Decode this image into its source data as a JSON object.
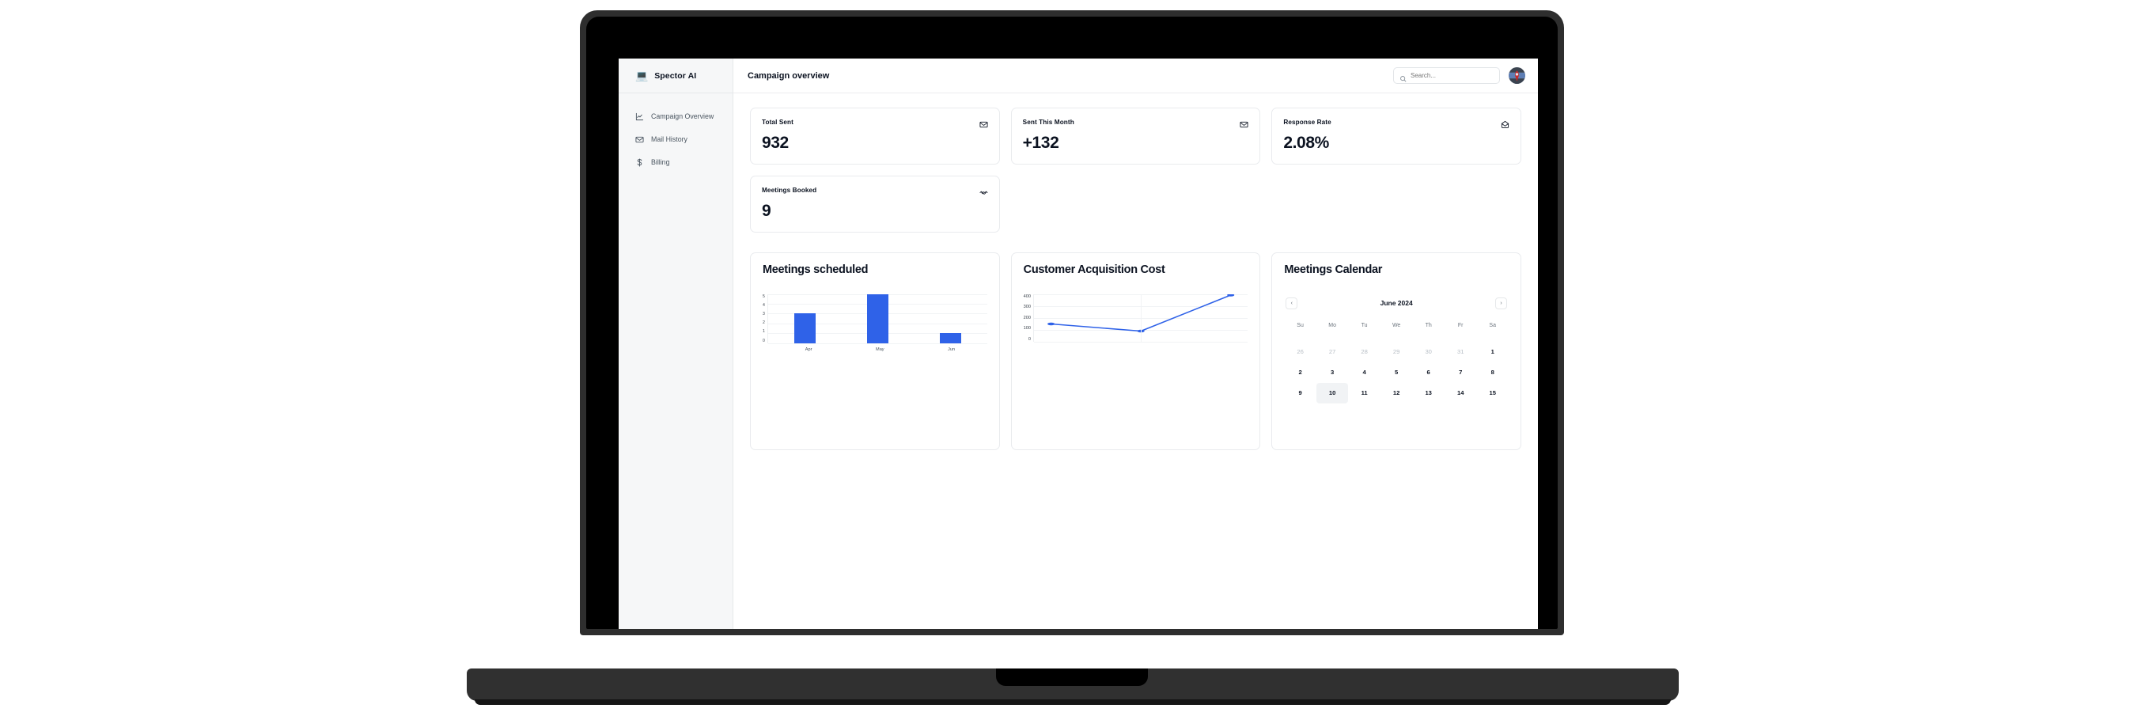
{
  "sidebar": {
    "brand": {
      "logo_icon": "laptop-logo-icon",
      "name": "Spector AI"
    },
    "items": [
      {
        "label": "Campaign Overview",
        "icon": "line-chart-icon"
      },
      {
        "label": "Mail History",
        "icon": "envelope-icon"
      },
      {
        "label": "Billing",
        "icon": "dollar-icon"
      }
    ]
  },
  "topbar": {
    "title": "Campaign overview",
    "search": {
      "placeholder": "Search...",
      "value": "",
      "icon": "search-icon"
    },
    "avatar_icon": "user-avatar"
  },
  "stats": [
    {
      "label": "Total Sent",
      "value": "932",
      "icon": "envelope-icon"
    },
    {
      "label": "Sent This Month",
      "value": "+132",
      "icon": "envelope-icon"
    },
    {
      "label": "Response Rate",
      "value": "2.08%",
      "icon": "envelope-open-icon"
    },
    {
      "label": "Meetings Booked",
      "value": "9",
      "icon": "handshake-icon"
    }
  ],
  "panels": {
    "meetings_scheduled_title": "Meetings scheduled",
    "cac_title": "Customer Acquisition Cost",
    "calendar_title": "Meetings Calendar"
  },
  "calendar": {
    "month_label": "June 2024",
    "prev_icon": "chevron-left-icon",
    "next_icon": "chevron-right-icon",
    "dow": [
      "Su",
      "Mo",
      "Tu",
      "We",
      "Th",
      "Fr",
      "Sa"
    ],
    "weeks": [
      [
        {
          "d": "26",
          "muted": true
        },
        {
          "d": "27",
          "muted": true
        },
        {
          "d": "28",
          "muted": true
        },
        {
          "d": "29",
          "muted": true
        },
        {
          "d": "30",
          "muted": true
        },
        {
          "d": "31",
          "muted": true
        },
        {
          "d": "1",
          "muted": false
        }
      ],
      [
        {
          "d": "2"
        },
        {
          "d": "3"
        },
        {
          "d": "4"
        },
        {
          "d": "5"
        },
        {
          "d": "6"
        },
        {
          "d": "7"
        },
        {
          "d": "8"
        }
      ],
      [
        {
          "d": "9"
        },
        {
          "d": "10",
          "today": true
        },
        {
          "d": "11"
        },
        {
          "d": "12"
        },
        {
          "d": "13"
        },
        {
          "d": "14"
        },
        {
          "d": "15"
        }
      ]
    ]
  },
  "colors": {
    "accent": "#2f62e8",
    "sidebar_bg": "#f6f7f8",
    "card_border": "#e9ebee",
    "text": "#0b1220",
    "muted_text": "#6b747d"
  },
  "chart_data": [
    {
      "type": "bar",
      "title": "Meetings scheduled",
      "categories": [
        "Apr",
        "May",
        "Jun"
      ],
      "values": [
        3,
        5,
        1
      ],
      "xlabel": "",
      "ylabel": "",
      "ylim": [
        0,
        5
      ],
      "yticks": [
        5,
        4,
        3,
        2,
        1,
        0
      ],
      "grid": true,
      "legend": false,
      "series_color": "#2f62e8"
    },
    {
      "type": "line",
      "title": "Customer Acquisition Cost",
      "x": [
        1,
        2,
        3
      ],
      "values": [
        150,
        90,
        420
      ],
      "xlabel": "",
      "ylabel": "",
      "ylim": [
        0,
        400
      ],
      "yticks": [
        400,
        300,
        200,
        100,
        0
      ],
      "grid": true,
      "legend": false,
      "markers": true,
      "series_color": "#2f62e8"
    }
  ]
}
